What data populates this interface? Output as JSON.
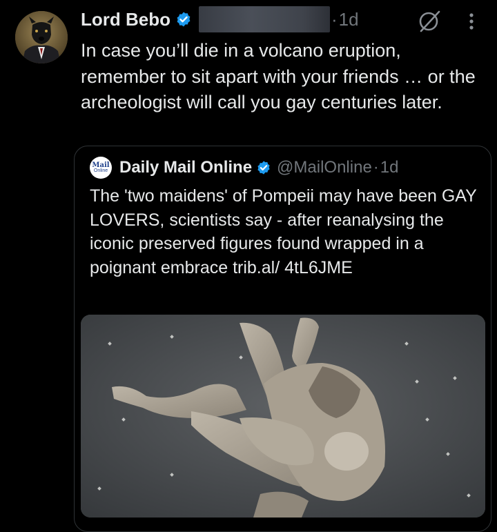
{
  "tweet": {
    "author_name": "Lord Bebo",
    "dot": "·",
    "time": "1d",
    "text": "In case you’ll die in a volcano eruption, remember to sit apart with your friends … or the archeologist will call you gay centuries later.",
    "avatar_icon": "dog-in-suit-avatar",
    "icons": [
      "verified-badge-icon",
      "grok-icon",
      "more-options-icon"
    ]
  },
  "quote": {
    "logo_line1": "Mail",
    "logo_line2": "Online",
    "name": "Daily Mail Online",
    "handle": "@MailOnline",
    "dot": "·",
    "time": "1d",
    "text": "The 'two maidens' of Pompeii may have been GAY LOVERS, scientists say - after reanalysing the iconic preserved figures found wrapped in a poignant embrace trib.al/ 4tL6JME",
    "media_icon": "pompeii-plaster-casts-photo"
  },
  "colors": {
    "background": "#000000",
    "text": "#e7e9ea",
    "secondary": "#71767b",
    "verified": "#1d9bf0",
    "border": "#2f3336"
  }
}
